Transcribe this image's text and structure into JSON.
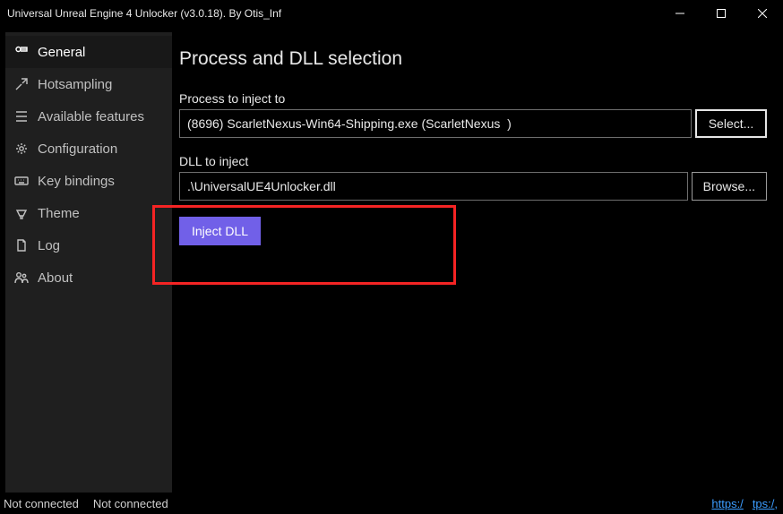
{
  "titlebar": {
    "text": "Universal Unreal Engine 4 Unlocker (v3.0.18). By Otis_Inf"
  },
  "sidebar": {
    "items": [
      {
        "label": "General"
      },
      {
        "label": "Hotsampling"
      },
      {
        "label": "Available features"
      },
      {
        "label": "Configuration"
      },
      {
        "label": "Key bindings"
      },
      {
        "label": "Theme"
      },
      {
        "label": "Log"
      },
      {
        "label": "About"
      }
    ]
  },
  "main": {
    "title": "Process and DLL selection",
    "process_label": "Process to inject to",
    "process_value": "(8696) ScarletNexus-Win64-Shipping.exe (ScarletNexus  )",
    "select_btn": "Select...",
    "dll_label": "DLL to inject",
    "dll_value": ".\\UniversalUE4Unlocker.dll",
    "browse_btn": "Browse...",
    "inject_btn": "Inject DLL"
  },
  "statusbar": {
    "left1": "Not connected",
    "left2": "Not connected",
    "link1": "https:/",
    "link2": "tps:/,"
  }
}
